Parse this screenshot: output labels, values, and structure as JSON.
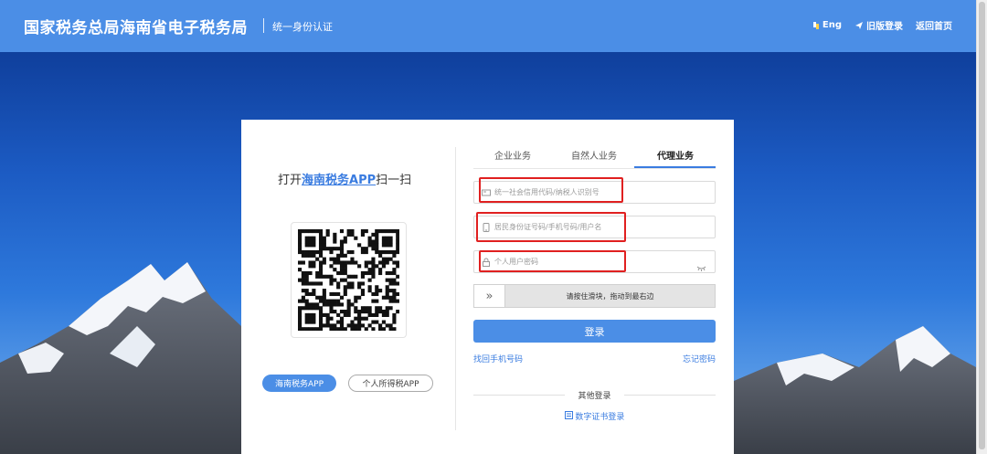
{
  "header": {
    "title": "国家税务总局海南省电子税务局",
    "subtitle": "统一身份认证",
    "nav": [
      {
        "icon": "language-icon",
        "label": "Eng"
      },
      {
        "icon": "send-icon",
        "label": "旧版登录"
      },
      {
        "icon": "",
        "label": "返回首页"
      }
    ]
  },
  "qr_panel": {
    "scan_prefix": "打开",
    "scan_app": "海南税务APP",
    "scan_suffix": "扫一扫",
    "app_buttons": [
      "海南税务APP",
      "个人所得税APP"
    ],
    "active_app": 0
  },
  "tabs": {
    "items": [
      "企业业务",
      "自然人业务",
      "代理业务"
    ],
    "active_index": 2
  },
  "form": {
    "credit_code_placeholder": "统一社会信用代码/纳税人识别号",
    "id_placeholder": "居民身份证号码/手机号码/用户名",
    "password_placeholder": "个人用户密码",
    "slider_text": "请按住滑块，拖动到最右边",
    "login_button": "登录",
    "find_phone_link": "找回手机号码",
    "forgot_password_link": "忘记密码",
    "other_login_label": "其他登录",
    "cert_login_link": "数字证书登录"
  },
  "colors": {
    "accent": "#4b8ee6",
    "link": "#3a7ce0",
    "highlight": "#e02020"
  }
}
